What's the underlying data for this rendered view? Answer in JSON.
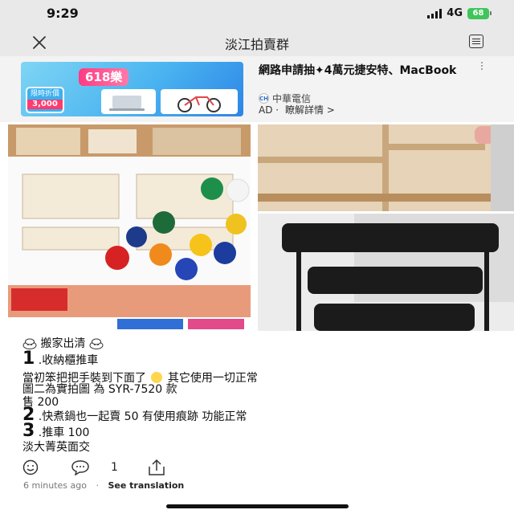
{
  "status_bar": {
    "time": "9:29",
    "network": "4G",
    "battery": "68"
  },
  "nav": {
    "title": "淡江拍賣群"
  },
  "ad": {
    "banner_title": "618樂",
    "banner_price_label": "限時折價",
    "banner_price": "3,000",
    "title": "網路申請抽✦4萬元捷安特、MacBook",
    "sponsor": "中華電信",
    "label": "AD",
    "separator": "·",
    "learn_more": "瞭解詳情 >"
  },
  "post": {
    "header_text": "搬家出清",
    "items": [
      {
        "num": "1",
        "text": ".收納櫃推車"
      },
      {
        "text_a": "當初笨把把手裝到下面了",
        "text_b": "其它使用一切正常"
      },
      {
        "text": "圖二為實拍圖 為 SYR-7520 款"
      },
      {
        "text": "售 200"
      },
      {
        "num": "2",
        "text": ".快煮鍋也一起賣 50 有使用痕跡 功能正常"
      },
      {
        "num": "3",
        "text": ".推車 100"
      },
      {
        "text": "淡大菁英面交"
      }
    ]
  },
  "actions": {
    "comment_count": "1"
  },
  "meta": {
    "time": "6 minutes ago",
    "separator": "·",
    "translate": "See translation"
  },
  "icons": {
    "close": "close-icon",
    "menu": "menu-icon",
    "react": "smiley-icon",
    "comment": "comment-icon",
    "share": "share-icon"
  },
  "colors": {
    "battery": "#3fc55a",
    "ad_pink": "#ff3b82",
    "ad_blue": "#4ab4f0"
  }
}
